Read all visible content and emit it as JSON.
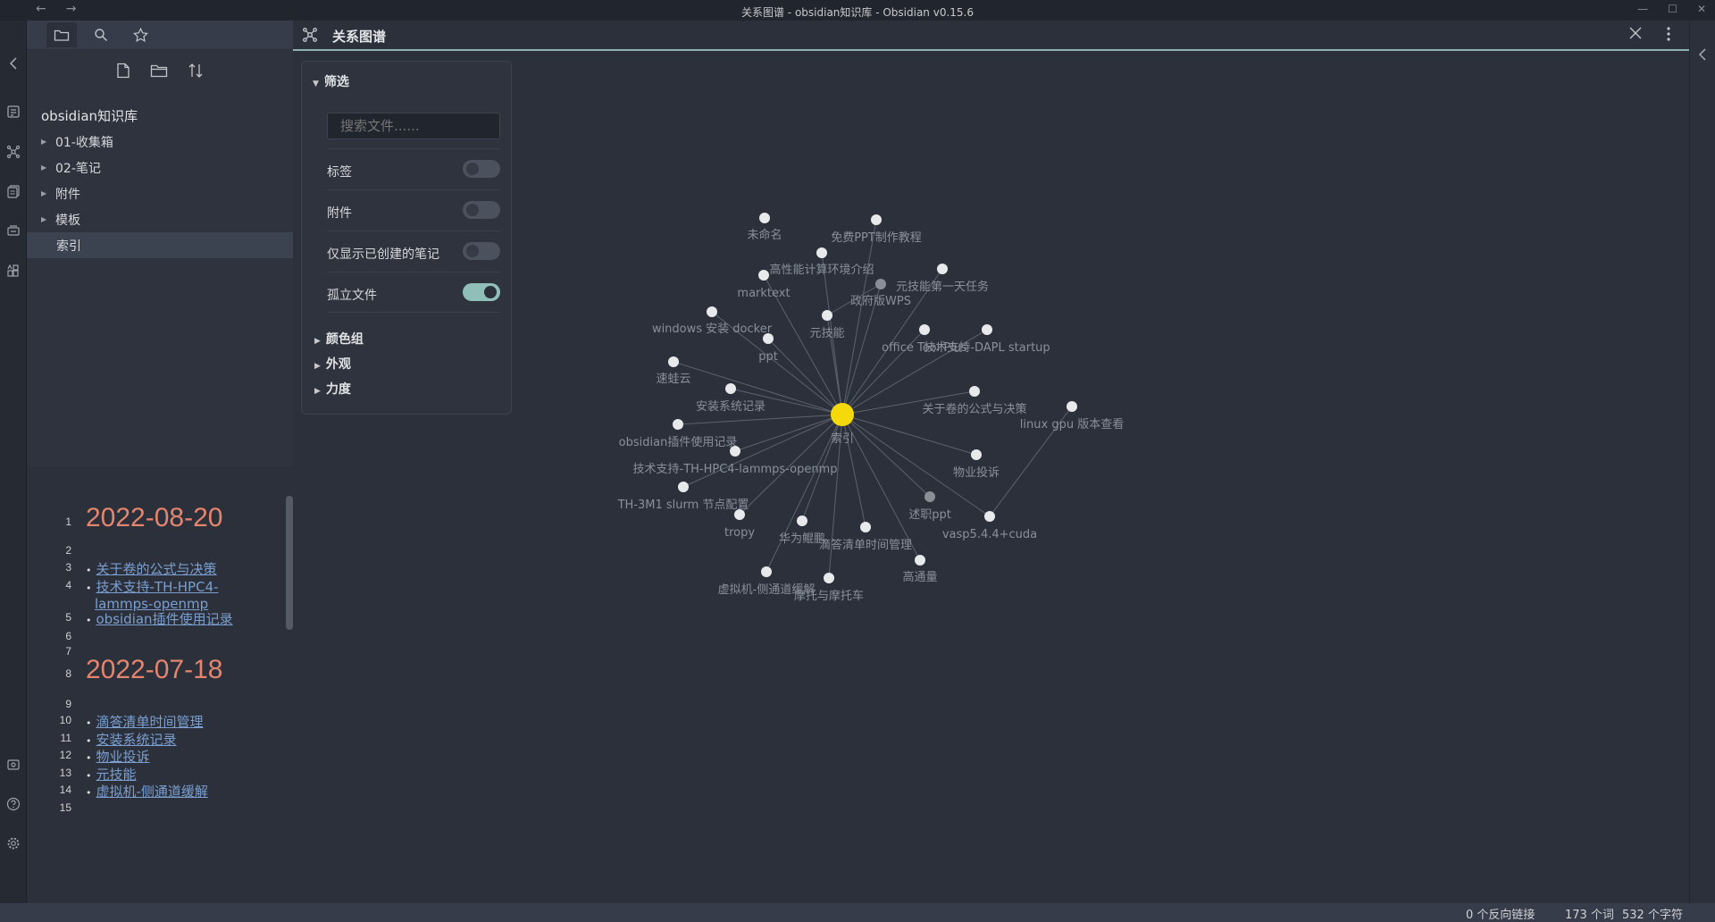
{
  "titlebar": {
    "title": "关系图谱 - obsidian知识库 - Obsidian v0.15.6",
    "back": "←",
    "forward": "→",
    "minimize": "—",
    "maximize": "☐",
    "close": "✕"
  },
  "left_sidebar": {
    "vault_name": "obsidian知识库",
    "tree": [
      {
        "label": "01-收集箱",
        "type": "folder"
      },
      {
        "label": "02-笔记",
        "type": "folder"
      },
      {
        "label": "附件",
        "type": "folder"
      },
      {
        "label": "模板",
        "type": "folder"
      },
      {
        "label": "索引",
        "type": "file",
        "selected": true
      }
    ]
  },
  "editor": {
    "lines": [
      {
        "n": "1",
        "kind": "heading",
        "text": "2022-08-20"
      },
      {
        "n": "2",
        "kind": "blank",
        "text": ""
      },
      {
        "n": "3",
        "kind": "link",
        "text": "关于卷的公式与决策"
      },
      {
        "n": "4",
        "kind": "link",
        "text": "技术支持-TH-HPC4-",
        "text2": "lammps-openmp"
      },
      {
        "n": "5",
        "kind": "link",
        "text": "obsidian插件使用记录"
      },
      {
        "n": "6",
        "kind": "blank",
        "text": ""
      },
      {
        "n": "7",
        "kind": "blank",
        "text": ""
      },
      {
        "n": "8",
        "kind": "heading",
        "text": "2022-07-18"
      },
      {
        "n": "9",
        "kind": "blank",
        "text": ""
      },
      {
        "n": "10",
        "kind": "link",
        "text": "滴答清单时间管理"
      },
      {
        "n": "11",
        "kind": "link",
        "text": "安装系统记录"
      },
      {
        "n": "12",
        "kind": "link",
        "text": "物业投诉"
      },
      {
        "n": "13",
        "kind": "link",
        "text": "元技能"
      },
      {
        "n": "14",
        "kind": "link",
        "text": "虚拟机-侧通道缓解"
      },
      {
        "n": "15",
        "kind": "blank",
        "text": ""
      }
    ]
  },
  "graph": {
    "title": "关系图谱",
    "filters": {
      "section_filter": "筛选",
      "search_placeholder": "搜索文件......",
      "toggles": [
        {
          "label": "标签",
          "on": false
        },
        {
          "label": "附件",
          "on": false
        },
        {
          "label": "仅显示已创建的笔记",
          "on": false
        },
        {
          "label": "孤立文件",
          "on": true
        }
      ],
      "sections": [
        "颜色组",
        "外观",
        "力度"
      ]
    },
    "colors": {
      "center": "#f5d90a",
      "node": "#e8e9eb",
      "dim_node": "#8a8e96",
      "edge": "#5c6370",
      "label": "#8a9099"
    },
    "center": {
      "label": "索引"
    },
    "nodes": [
      {
        "label": "未命名",
        "linked": false
      },
      {
        "label": "免费PPT制作教程",
        "linked": true
      },
      {
        "label": "高性能计算环境介绍",
        "linked": true
      },
      {
        "label": "marktext",
        "linked": true
      },
      {
        "label": "政府版WPS",
        "linked": true,
        "dim": true
      },
      {
        "label": "元技能第一天任务",
        "linked": true
      },
      {
        "label": "windows 安装 docker",
        "linked": true
      },
      {
        "label": "元技能",
        "linked": true
      },
      {
        "label": "ppt",
        "linked": true
      },
      {
        "label": "office Tool Plus",
        "linked": true
      },
      {
        "label": "技术支持-DAPL startup",
        "linked": true
      },
      {
        "label": "速蛙云",
        "linked": true
      },
      {
        "label": "安装系统记录",
        "linked": true
      },
      {
        "label": "关于卷的公式与决策",
        "linked": true
      },
      {
        "label": "linux gpu 版本查看",
        "linked": false
      },
      {
        "label": "obsidian插件使用记录",
        "linked": true
      },
      {
        "label": "技术支持-TH-HPC4-lammps-openmp",
        "linked": true
      },
      {
        "label": "物业投诉",
        "linked": true
      },
      {
        "label": "TH-3M1 slurm 节点配置",
        "linked": true
      },
      {
        "label": "述职ppt",
        "linked": true,
        "dim": true
      },
      {
        "label": "tropy",
        "linked": true
      },
      {
        "label": "华为鲲鹏",
        "linked": true
      },
      {
        "label": "滴答清单时间管理",
        "linked": true
      },
      {
        "label": "vasp5.4.4+cuda",
        "linked": true
      },
      {
        "label": "高通量",
        "linked": true
      },
      {
        "label": "虚拟机-侧通道缓解",
        "linked": true
      },
      {
        "label": "摩托与摩托车",
        "linked": true
      }
    ],
    "extra_edges": [
      [
        "linux gpu 版本查看",
        "vasp5.4.4+cuda"
      ],
      [
        "政府版WPS",
        "元技能"
      ]
    ]
  },
  "statusbar": {
    "backlinks": "0 个反向链接",
    "words": "173 个词",
    "chars": "532 个字符"
  }
}
